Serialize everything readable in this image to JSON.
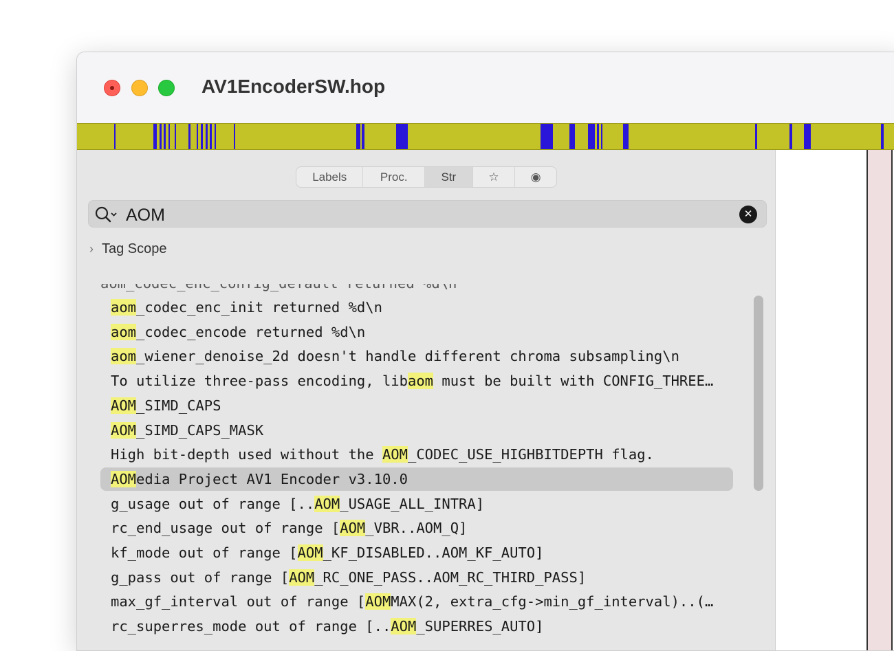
{
  "window": {
    "title": "AV1EncoderSW.hop"
  },
  "colors": {
    "timeline_bg": "#c3c227",
    "timeline_tick": "#2a16d8",
    "highlight": "#f2f27a"
  },
  "tabs": [
    {
      "label": "Labels",
      "active": false
    },
    {
      "label": "Proc.",
      "active": false
    },
    {
      "label": "Str",
      "active": true
    },
    {
      "label": "☆",
      "active": false,
      "icon": "star-icon"
    },
    {
      "label": "◉",
      "active": false,
      "icon": "radio-icon"
    }
  ],
  "search": {
    "value": "AOM",
    "icon": "search-icon",
    "clear_icon": "clear-icon"
  },
  "tag_scope": {
    "label": "Tag Scope",
    "icon": "chevron-right-icon"
  },
  "strings": [
    {
      "pre": "",
      "match": "aom",
      "post": "_codec_enc_init returned %d\\n"
    },
    {
      "pre": "",
      "match": "aom",
      "post": "_codec_encode returned %d\\n"
    },
    {
      "pre": "",
      "match": "aom",
      "post": "_wiener_denoise_2d doesn't handle different chroma subsampling\\n"
    },
    {
      "pre": "To utilize three-pass encoding, lib",
      "match": "aom",
      "post": " must be built with CONFIG_THREE…"
    },
    {
      "pre": "",
      "match": "AOM",
      "post": "_SIMD_CAPS"
    },
    {
      "pre": "",
      "match": "AOM",
      "post": "_SIMD_CAPS_MASK"
    },
    {
      "pre": "High bit-depth used without the ",
      "match": "AOM",
      "post": "_CODEC_USE_HIGHBITDEPTH flag."
    },
    {
      "pre": "",
      "match": "AOM",
      "post": "edia Project AV1 Encoder v3.10.0",
      "selected": true
    },
    {
      "pre": "g_usage out of range [..",
      "match": "AOM",
      "post": "_USAGE_ALL_INTRA]"
    },
    {
      "pre": "rc_end_usage out of range [",
      "match": "AOM",
      "post": "_VBR..AOM_Q]"
    },
    {
      "pre": "kf_mode out of range [",
      "match": "AOM",
      "post": "_KF_DISABLED..AOM_KF_AUTO]"
    },
    {
      "pre": "g_pass out of range [",
      "match": "AOM",
      "post": "_RC_ONE_PASS..AOM_RC_THIRD_PASS]"
    },
    {
      "pre": "max_gf_interval out of range [",
      "match": "AOM",
      "post": "MAX(2, extra_cfg->min_gf_interval)..(…"
    },
    {
      "pre": "rc_superres_mode out of range [..",
      "match": "AOM",
      "post": "_SUPERRES_AUTO]"
    }
  ]
}
